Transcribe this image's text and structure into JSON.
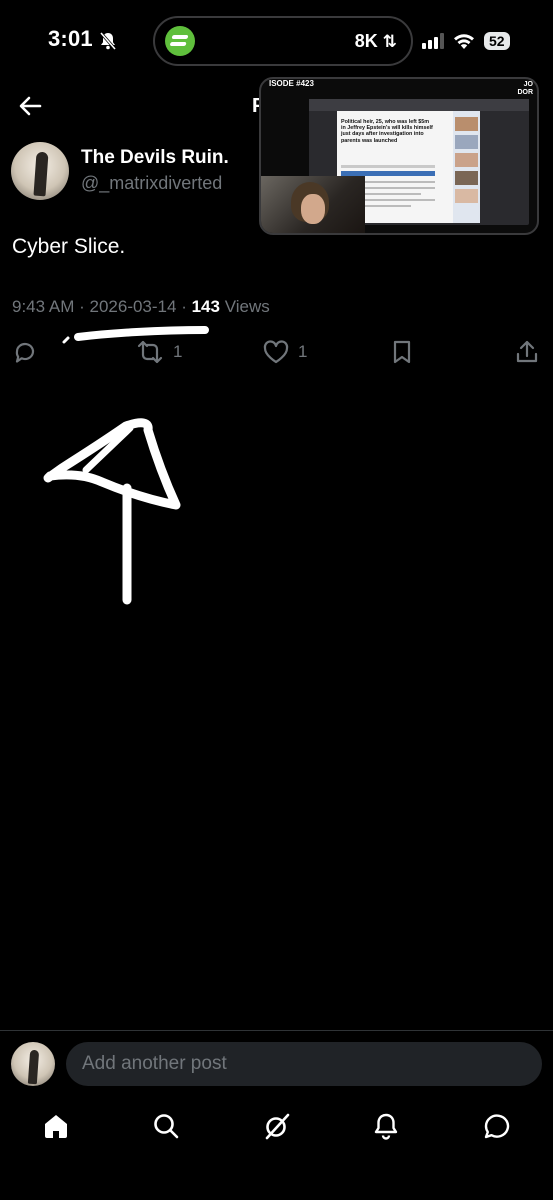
{
  "status_bar": {
    "time": "3:01",
    "signal_text": "8K",
    "battery": "52"
  },
  "header": {
    "title_fragment": "P"
  },
  "pip": {
    "episode": "ISODE #423",
    "corner": "JO\nDOR",
    "headline": "Political heir, 25, who was left $5m in Jeffrey Epstein's will kills himself just days after investigation into parents was launched"
  },
  "post": {
    "author_name": "The Devils Ruin.",
    "author_handle": "@_matrixdiverted",
    "text": "Cyber Slice.",
    "time": "9:43 AM",
    "date": "2026-03-14",
    "views_count": "143",
    "views_label": "Views",
    "reposts": "1",
    "likes": "1"
  },
  "reply": {
    "placeholder": "Add another post"
  },
  "colors": {
    "background": "#000000",
    "muted": "#71767b",
    "text": "#e7e9ea",
    "input_bg": "#202327"
  },
  "icons": [
    "back-arrow-icon",
    "reply-icon",
    "repost-icon",
    "like-icon",
    "bookmark-icon",
    "share-icon",
    "home-icon",
    "search-icon",
    "grok-icon",
    "notifications-icon",
    "messages-icon"
  ]
}
